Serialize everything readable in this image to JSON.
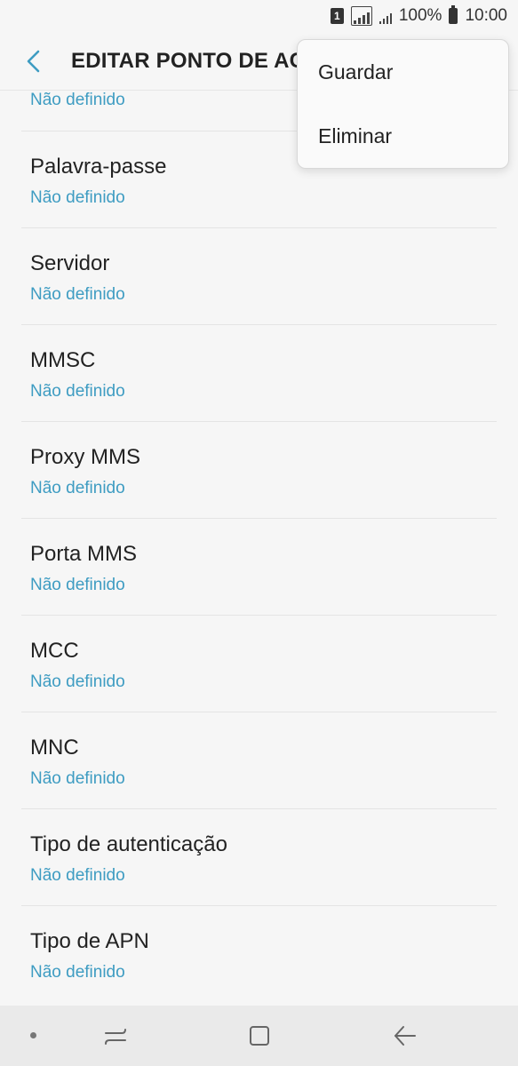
{
  "status_bar": {
    "sim_label": "1",
    "battery": "100%",
    "time": "10:00"
  },
  "header": {
    "title": "EDITAR PONTO DE ACESSO"
  },
  "menu": {
    "items": [
      {
        "label": "Guardar"
      },
      {
        "label": "Eliminar"
      }
    ]
  },
  "settings": {
    "partial_value": "Não definido",
    "items": [
      {
        "title": "Palavra-passe",
        "value": "Não definido"
      },
      {
        "title": "Servidor",
        "value": "Não definido"
      },
      {
        "title": "MMSC",
        "value": "Não definido"
      },
      {
        "title": "Proxy MMS",
        "value": "Não definido"
      },
      {
        "title": "Porta MMS",
        "value": "Não definido"
      },
      {
        "title": "MCC",
        "value": "Não definido"
      },
      {
        "title": "MNC",
        "value": "Não definido"
      },
      {
        "title": "Tipo de autenticação",
        "value": "Não definido"
      },
      {
        "title": "Tipo de APN",
        "value": "Não definido"
      }
    ]
  },
  "colors": {
    "accent": "#3e9cc2",
    "background": "#f6f6f6"
  },
  "nav_bar": {
    "icons": [
      "dot-icon",
      "recents-icon",
      "home-icon",
      "back-icon"
    ]
  }
}
